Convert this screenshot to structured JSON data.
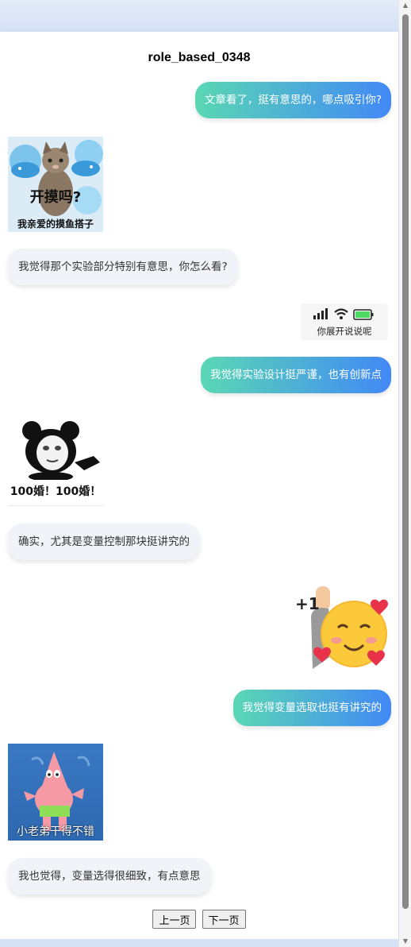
{
  "page": {
    "title": "role_based_0348"
  },
  "messages": {
    "m1": "文章看了，挺有意思的，哪点吸引你?",
    "m3": "我觉得那个实验部分特别有意思，你怎么看?",
    "m5": "我觉得实验设计挺严谨，也有创新点",
    "m7": "确实，尤其是变量控制那块挺讲究的",
    "m9": "我觉得变量选取也挺有讲究的",
    "m11": "我也觉得，变量选得很细致，有点意思"
  },
  "stickers": {
    "cat": {
      "caption_big": "开摸吗?",
      "caption_small": "我亲爱的摸鱼搭子"
    },
    "phone": {
      "caption": "你展开说说呢"
    },
    "panda": {
      "caption": "100婚！100婚！"
    },
    "emoji": {
      "label": "+1"
    },
    "patrick": {
      "caption": "小老弟干得不错"
    }
  },
  "pager": {
    "prev": "上一页",
    "next": "下一页"
  },
  "colors": {
    "outgoing_start": "#5ad7b4",
    "outgoing_end": "#4289f6",
    "incoming_bg": "#f1f3f8"
  }
}
